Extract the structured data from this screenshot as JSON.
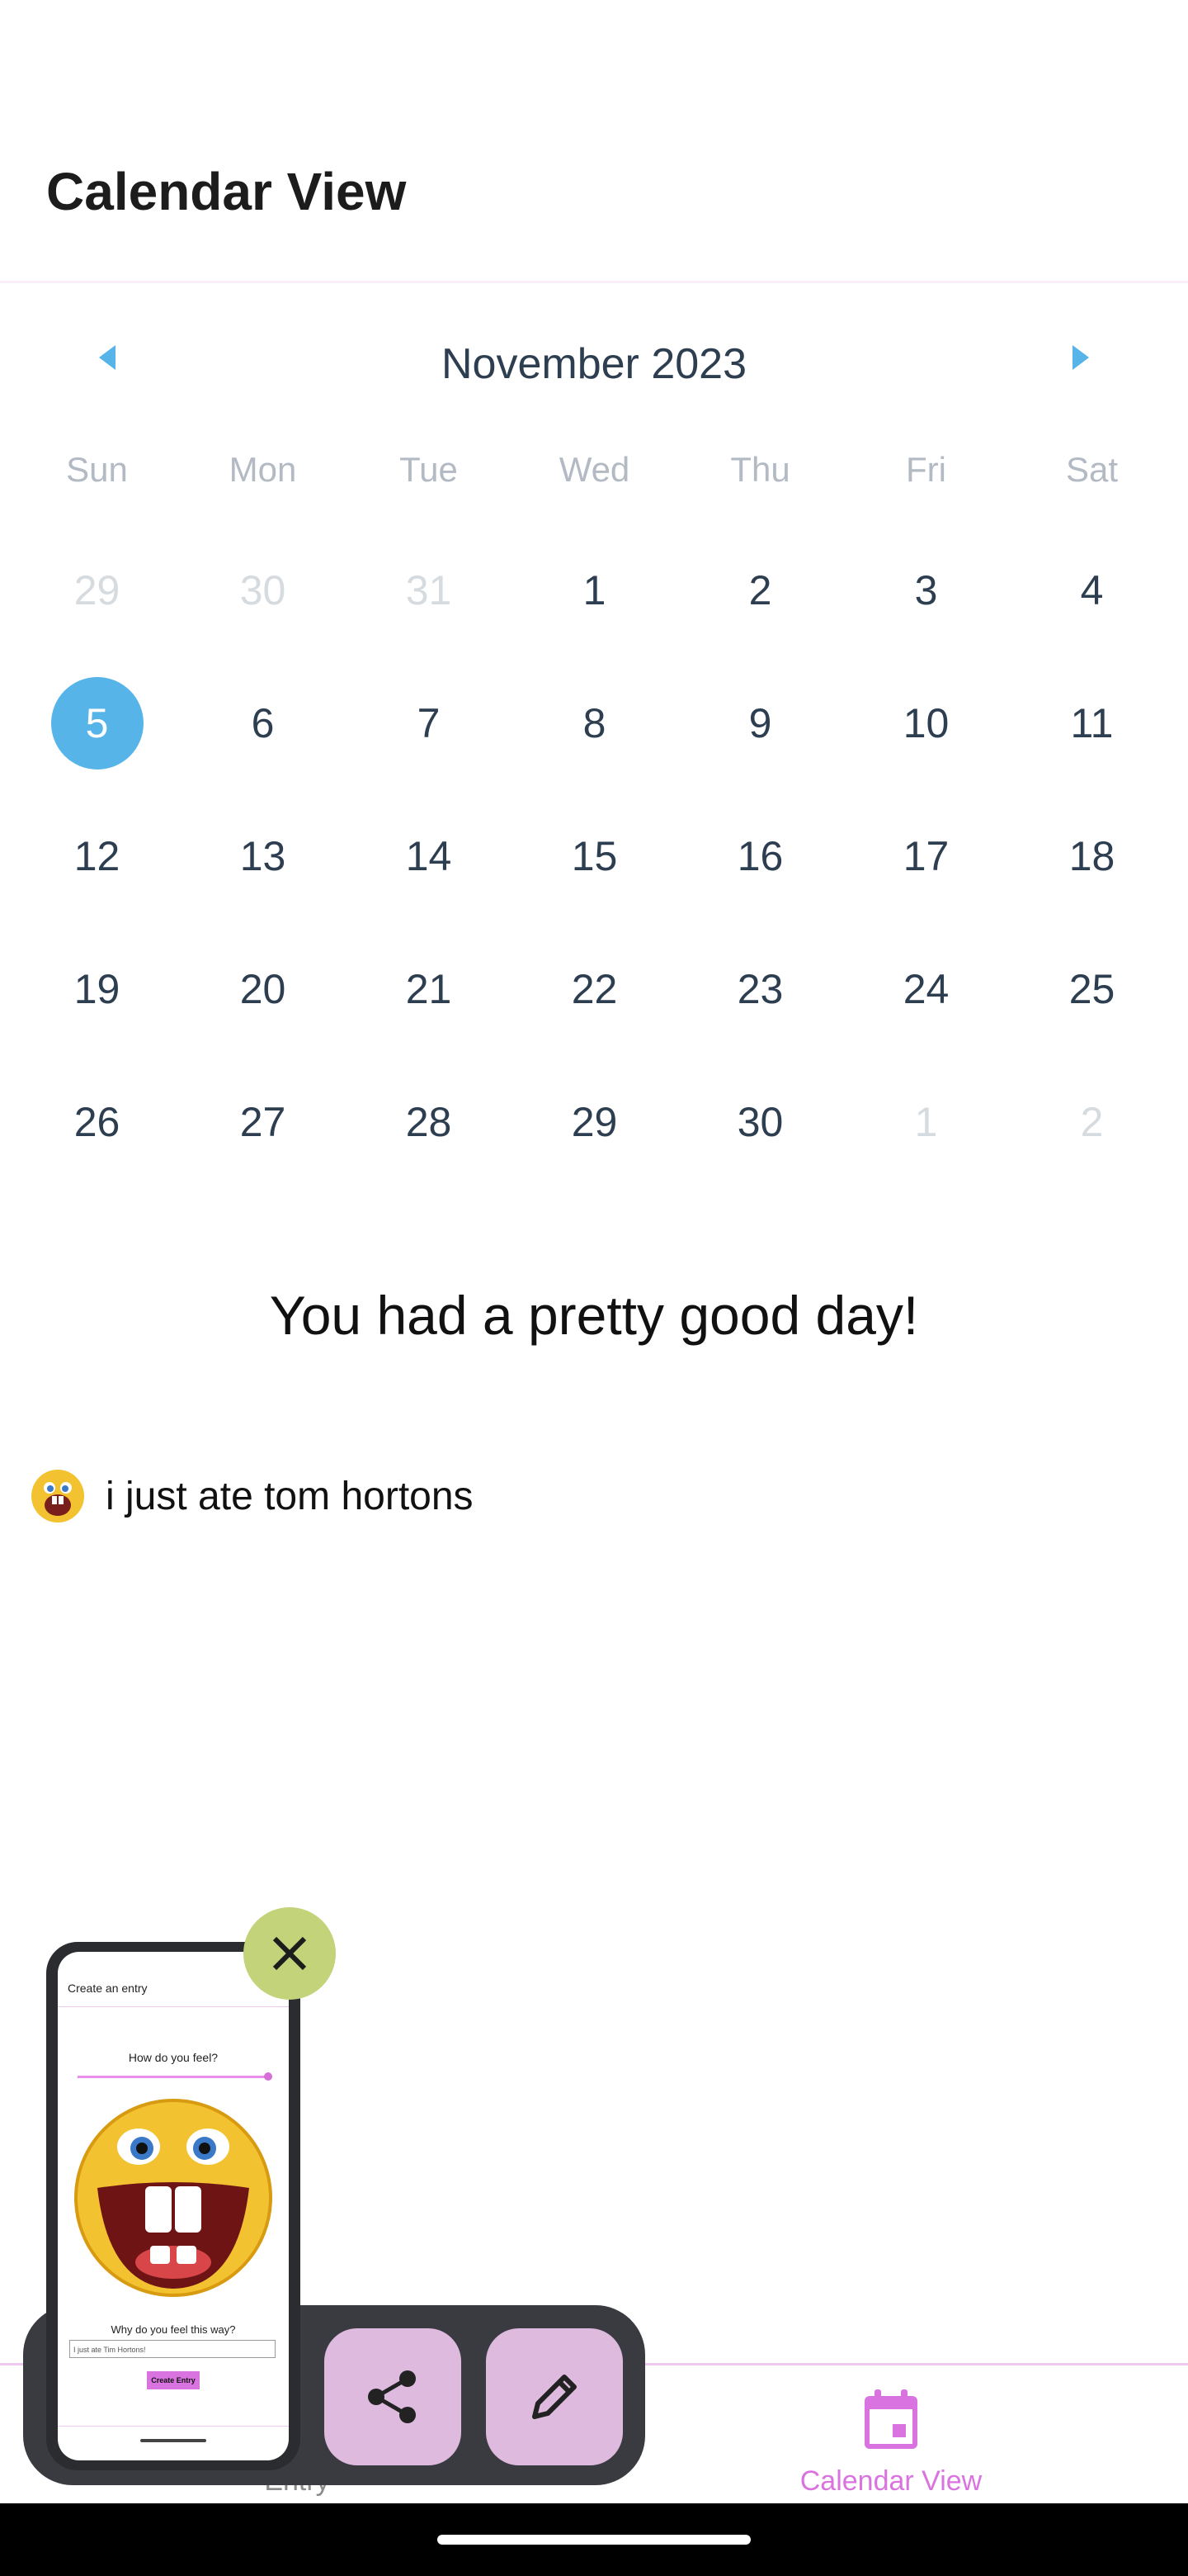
{
  "header": {
    "title": "Calendar View"
  },
  "calendar": {
    "month_label": "November 2023",
    "days_of_week": [
      "Sun",
      "Mon",
      "Tue",
      "Wed",
      "Thu",
      "Fri",
      "Sat"
    ],
    "weeks": [
      [
        "29",
        "30",
        "31",
        "1",
        "2",
        "3",
        "4"
      ],
      [
        "5",
        "6",
        "7",
        "8",
        "9",
        "10",
        "11"
      ],
      [
        "12",
        "13",
        "14",
        "15",
        "16",
        "17",
        "18"
      ],
      [
        "19",
        "20",
        "21",
        "22",
        "23",
        "24",
        "25"
      ],
      [
        "26",
        "27",
        "28",
        "29",
        "30",
        "1",
        "2"
      ]
    ],
    "selected_day": "5",
    "accent_color": "#56b4e9"
  },
  "summary": {
    "text": "You had a pretty good day!"
  },
  "entry": {
    "text": "i just ate tom hortons",
    "icon": "laughing-emoji-icon"
  },
  "tabs": {
    "entry_label": "Entry",
    "calendar_label": "Calendar View",
    "active_color": "#d973df"
  },
  "screenshot_preview": {
    "title": "Create an entry",
    "question": "How do you feel?",
    "why_label": "Why do you feel this way?",
    "input_value": "I just ate Tim Hortons!",
    "button_label": "Create Entry"
  },
  "actions": {
    "share_icon": "share-icon",
    "edit_icon": "pencil-icon",
    "close_icon": "close-icon"
  }
}
